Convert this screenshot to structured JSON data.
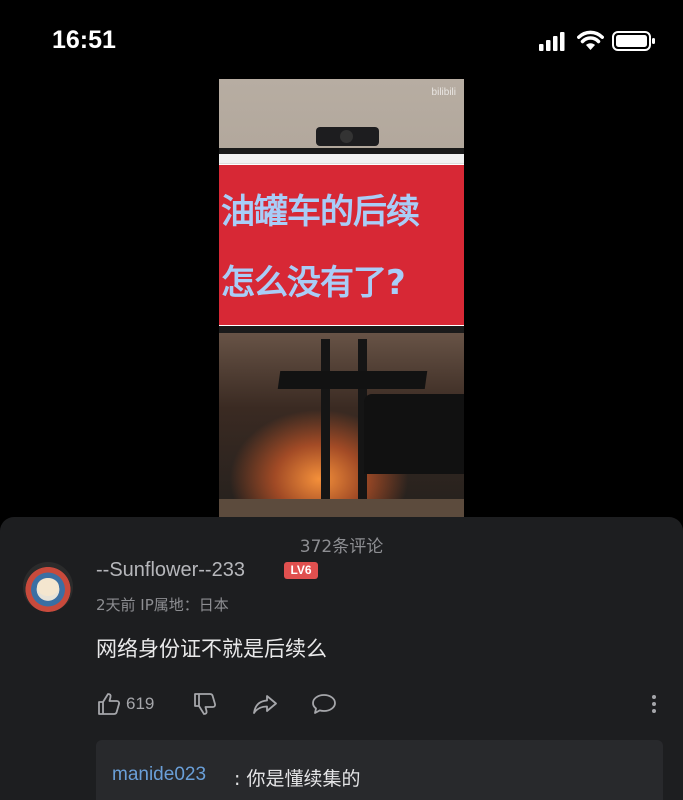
{
  "status_bar": {
    "time": "16:51",
    "icons": [
      "signal-icon",
      "wifi-icon",
      "battery-icon"
    ]
  },
  "video": {
    "watermark": "bilibili",
    "screen_text_line1": "油罐车的后续",
    "screen_text_line2": "怎么没有了?",
    "colors": {
      "screen_bg": "#d72835",
      "screen_text": "#a9cdf7"
    }
  },
  "comments": {
    "count_label": "372条评论",
    "items": [
      {
        "username": "--Sunflower--233",
        "level": "LV6",
        "meta": "2天前  IP属地：日本",
        "text": "网络身份证不就是后续么",
        "likes": "619",
        "replies": [
          {
            "user": "manide023",
            "text": ": 你是懂续集的"
          }
        ]
      }
    ]
  },
  "colors": {
    "panel_bg": "#1d1e20",
    "reply_bg": "#28292c",
    "link": "#6a9fd8",
    "level_badge": "#e0504f"
  }
}
